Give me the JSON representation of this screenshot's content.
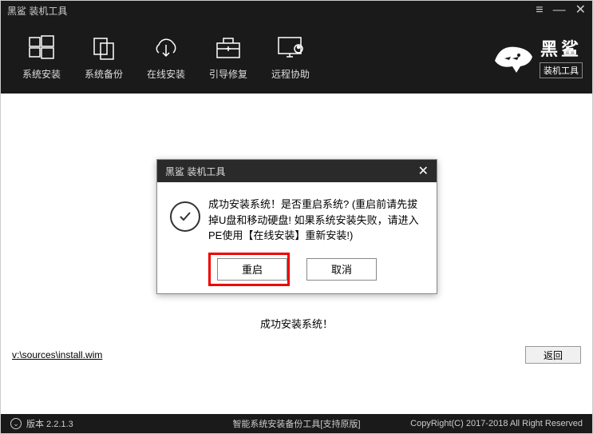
{
  "titlebar": {
    "title": "黑鲨 装机工具"
  },
  "header": {
    "tabs": [
      {
        "label": "系统安装"
      },
      {
        "label": "系统备份"
      },
      {
        "label": "在线安装"
      },
      {
        "label": "引导修复"
      },
      {
        "label": "远程协助"
      }
    ],
    "logo": {
      "main": "黑鲨",
      "sub": "装机工具"
    }
  },
  "dialog": {
    "title": "黑鲨 装机工具",
    "message": "成功安装系统！是否重启系统? (重启前请先拔掉U盘和移动硬盘! 如果系统安装失败，请进入PE使用【在线安装】重新安装!)",
    "restart_label": "重启",
    "cancel_label": "取消"
  },
  "status": {
    "text": "成功安装系统！"
  },
  "bottom": {
    "file_path": "v:\\sources\\install.wim",
    "back_label": "返回"
  },
  "footer": {
    "version_label": "版本 2.2.1.3",
    "center_text": "智能系统安装备份工具[支持原版]",
    "copyright": "CopyRight(C) 2017-2018 All Right Reserved"
  }
}
